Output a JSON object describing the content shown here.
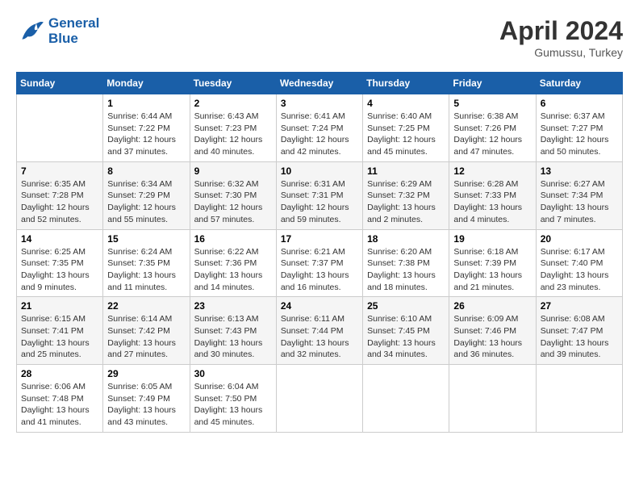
{
  "header": {
    "logo_line1": "General",
    "logo_line2": "Blue",
    "month": "April 2024",
    "location": "Gumussu, Turkey"
  },
  "days_of_week": [
    "Sunday",
    "Monday",
    "Tuesday",
    "Wednesday",
    "Thursday",
    "Friday",
    "Saturday"
  ],
  "weeks": [
    [
      {
        "day": "",
        "info": ""
      },
      {
        "day": "1",
        "info": "Sunrise: 6:44 AM\nSunset: 7:22 PM\nDaylight: 12 hours\nand 37 minutes."
      },
      {
        "day": "2",
        "info": "Sunrise: 6:43 AM\nSunset: 7:23 PM\nDaylight: 12 hours\nand 40 minutes."
      },
      {
        "day": "3",
        "info": "Sunrise: 6:41 AM\nSunset: 7:24 PM\nDaylight: 12 hours\nand 42 minutes."
      },
      {
        "day": "4",
        "info": "Sunrise: 6:40 AM\nSunset: 7:25 PM\nDaylight: 12 hours\nand 45 minutes."
      },
      {
        "day": "5",
        "info": "Sunrise: 6:38 AM\nSunset: 7:26 PM\nDaylight: 12 hours\nand 47 minutes."
      },
      {
        "day": "6",
        "info": "Sunrise: 6:37 AM\nSunset: 7:27 PM\nDaylight: 12 hours\nand 50 minutes."
      }
    ],
    [
      {
        "day": "7",
        "info": "Sunrise: 6:35 AM\nSunset: 7:28 PM\nDaylight: 12 hours\nand 52 minutes."
      },
      {
        "day": "8",
        "info": "Sunrise: 6:34 AM\nSunset: 7:29 PM\nDaylight: 12 hours\nand 55 minutes."
      },
      {
        "day": "9",
        "info": "Sunrise: 6:32 AM\nSunset: 7:30 PM\nDaylight: 12 hours\nand 57 minutes."
      },
      {
        "day": "10",
        "info": "Sunrise: 6:31 AM\nSunset: 7:31 PM\nDaylight: 12 hours\nand 59 minutes."
      },
      {
        "day": "11",
        "info": "Sunrise: 6:29 AM\nSunset: 7:32 PM\nDaylight: 13 hours\nand 2 minutes."
      },
      {
        "day": "12",
        "info": "Sunrise: 6:28 AM\nSunset: 7:33 PM\nDaylight: 13 hours\nand 4 minutes."
      },
      {
        "day": "13",
        "info": "Sunrise: 6:27 AM\nSunset: 7:34 PM\nDaylight: 13 hours\nand 7 minutes."
      }
    ],
    [
      {
        "day": "14",
        "info": "Sunrise: 6:25 AM\nSunset: 7:35 PM\nDaylight: 13 hours\nand 9 minutes."
      },
      {
        "day": "15",
        "info": "Sunrise: 6:24 AM\nSunset: 7:35 PM\nDaylight: 13 hours\nand 11 minutes."
      },
      {
        "day": "16",
        "info": "Sunrise: 6:22 AM\nSunset: 7:36 PM\nDaylight: 13 hours\nand 14 minutes."
      },
      {
        "day": "17",
        "info": "Sunrise: 6:21 AM\nSunset: 7:37 PM\nDaylight: 13 hours\nand 16 minutes."
      },
      {
        "day": "18",
        "info": "Sunrise: 6:20 AM\nSunset: 7:38 PM\nDaylight: 13 hours\nand 18 minutes."
      },
      {
        "day": "19",
        "info": "Sunrise: 6:18 AM\nSunset: 7:39 PM\nDaylight: 13 hours\nand 21 minutes."
      },
      {
        "day": "20",
        "info": "Sunrise: 6:17 AM\nSunset: 7:40 PM\nDaylight: 13 hours\nand 23 minutes."
      }
    ],
    [
      {
        "day": "21",
        "info": "Sunrise: 6:15 AM\nSunset: 7:41 PM\nDaylight: 13 hours\nand 25 minutes."
      },
      {
        "day": "22",
        "info": "Sunrise: 6:14 AM\nSunset: 7:42 PM\nDaylight: 13 hours\nand 27 minutes."
      },
      {
        "day": "23",
        "info": "Sunrise: 6:13 AM\nSunset: 7:43 PM\nDaylight: 13 hours\nand 30 minutes."
      },
      {
        "day": "24",
        "info": "Sunrise: 6:11 AM\nSunset: 7:44 PM\nDaylight: 13 hours\nand 32 minutes."
      },
      {
        "day": "25",
        "info": "Sunrise: 6:10 AM\nSunset: 7:45 PM\nDaylight: 13 hours\nand 34 minutes."
      },
      {
        "day": "26",
        "info": "Sunrise: 6:09 AM\nSunset: 7:46 PM\nDaylight: 13 hours\nand 36 minutes."
      },
      {
        "day": "27",
        "info": "Sunrise: 6:08 AM\nSunset: 7:47 PM\nDaylight: 13 hours\nand 39 minutes."
      }
    ],
    [
      {
        "day": "28",
        "info": "Sunrise: 6:06 AM\nSunset: 7:48 PM\nDaylight: 13 hours\nand 41 minutes."
      },
      {
        "day": "29",
        "info": "Sunrise: 6:05 AM\nSunset: 7:49 PM\nDaylight: 13 hours\nand 43 minutes."
      },
      {
        "day": "30",
        "info": "Sunrise: 6:04 AM\nSunset: 7:50 PM\nDaylight: 13 hours\nand 45 minutes."
      },
      {
        "day": "",
        "info": ""
      },
      {
        "day": "",
        "info": ""
      },
      {
        "day": "",
        "info": ""
      },
      {
        "day": "",
        "info": ""
      }
    ]
  ]
}
